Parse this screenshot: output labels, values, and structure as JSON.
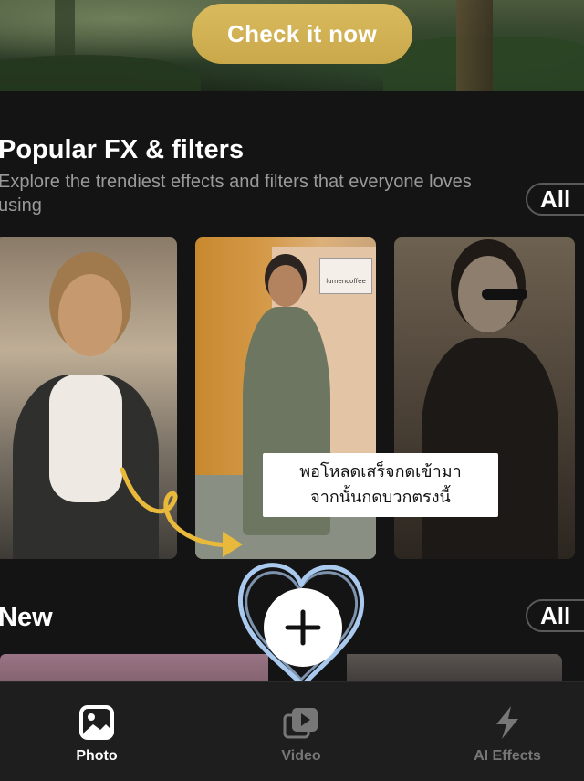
{
  "hero": {
    "cta_label": "Check it now",
    "cta_color": "#d4b456"
  },
  "popular": {
    "title": "Popular FX & filters",
    "description": "Explore the trendiest effects and filters that everyone loves using",
    "all_label": "All"
  },
  "new_section": {
    "title": "New",
    "all_label": "All"
  },
  "overlay_note": {
    "line1": "พอโหลดเสร็จกดเข้ามา",
    "line2": "จากนั้นกดบวกตรงนี้"
  },
  "card2_sign": "lumencoffee",
  "tabs": [
    {
      "label": "Photo",
      "icon": "photo-icon",
      "active": true
    },
    {
      "label": "Video",
      "icon": "video-icon",
      "active": false
    },
    {
      "label": "AI Effects",
      "icon": "lightning-icon",
      "active": false
    }
  ],
  "colors": {
    "accent_gold": "#d4b456",
    "annotation_blue": "#a9c9ef",
    "arrow_yellow": "#e8b93a"
  }
}
